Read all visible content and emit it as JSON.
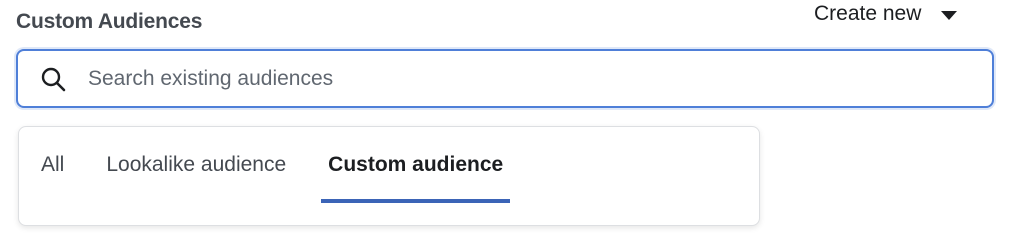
{
  "header": {
    "title": "Custom Audiences",
    "create_new_label": "Create new"
  },
  "search": {
    "placeholder": "Search existing audiences",
    "value": ""
  },
  "tabs": [
    {
      "label": "All",
      "active": false
    },
    {
      "label": "Lookalike audience",
      "active": false
    },
    {
      "label": "Custom audience",
      "active": true
    }
  ],
  "colors": {
    "focus_border": "#4f7fd8",
    "active_tab_underline": "#3b64b7"
  },
  "icons": {
    "search": "search-icon",
    "dropdown": "caret-down-icon"
  }
}
